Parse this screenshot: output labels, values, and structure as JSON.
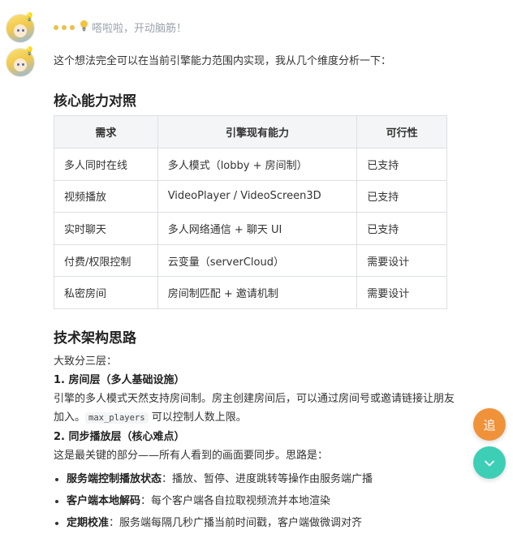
{
  "thinking": {
    "label": "嗒啦啦，开动脑筋！",
    "icon": "lightbulb-icon"
  },
  "message": {
    "intro": "这个想法完全可以在当前引擎能力范围内实现，我从几个维度分析一下：",
    "section1_title": "核心能力对照",
    "table": {
      "headers": [
        "需求",
        "引擎现有能力",
        "可行性"
      ],
      "rows": [
        [
          "多人同时在线",
          "多人模式（lobby + 房间制）",
          "已支持"
        ],
        [
          "视频播放",
          "VideoPlayer / VideoScreen3D",
          "已支持"
        ],
        [
          "实时聊天",
          "多人网络通信 + 聊天 UI",
          "已支持"
        ],
        [
          "付费/权限控制",
          "云变量（serverCloud）",
          "需要设计"
        ],
        [
          "私密房间",
          "房间制匹配 + 邀请机制",
          "需要设计"
        ]
      ]
    },
    "section2_title": "技术架构思路",
    "layers_intro": "大致分三层：",
    "layer1_title": "1. 房间层（多人基础设施）",
    "layer1_text_a": "引擎的多人模式天然支持房间制。房主创建房间后，可以通过房间号或邀请链接让朋友加入。",
    "layer1_code": "max_players",
    "layer1_text_b": " 可以控制人数上限。",
    "layer2_title": "2. 同步播放层（核心难点）",
    "layer2_text": "这是最关键的部分——所有人看到的画面要同步。思路是：",
    "bullets": [
      {
        "bold": "服务端控制播放状态",
        "text": "：播放、暂停、进度跳转等操作由服务端广播"
      },
      {
        "bold": "客户端本地解码",
        "text": "：每个客户端各自拉取视频流并本地渲染"
      },
      {
        "bold": "定期校准",
        "text": "：服务端每隔几秒广播当前时间戳，客户端做微调对齐"
      }
    ]
  },
  "fab": {
    "ask_label": "追",
    "down_icon": "chevron-down-icon"
  },
  "colors": {
    "accent_orange": "#f0923a",
    "accent_teal": "#3dcfb6",
    "thinking_dots": "#e8c04a"
  }
}
